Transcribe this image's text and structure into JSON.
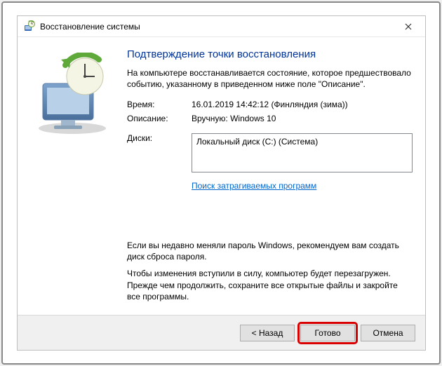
{
  "window": {
    "title": "Восстановление системы"
  },
  "main": {
    "heading": "Подтверждение точки восстановления",
    "description": "На компьютере восстанавливается состояние, которое предшествовало событию, указанному в приведенном ниже поле \"Описание\".",
    "time_label": "Время:",
    "time_value": "16.01.2019 14:42:12 (Финляндия (зима))",
    "desc_label": "Описание:",
    "desc_value": "Вручную: Windows 10",
    "disks_label": "Диски:",
    "disks_value": "Локальный диск (C:) (Система)",
    "affected_link": "Поиск затрагиваемых программ",
    "note1": "Если вы недавно меняли пароль Windows, рекомендуем вам создать диск сброса пароля.",
    "note2": "Чтобы изменения вступили в силу, компьютер будет перезагружен. Прежде чем продолжить, сохраните все открытые файлы и закройте все программы."
  },
  "buttons": {
    "back": "< Назад",
    "finish": "Готово",
    "cancel": "Отмена"
  },
  "icons": {
    "restore": "restore-icon",
    "close": "close-icon"
  }
}
